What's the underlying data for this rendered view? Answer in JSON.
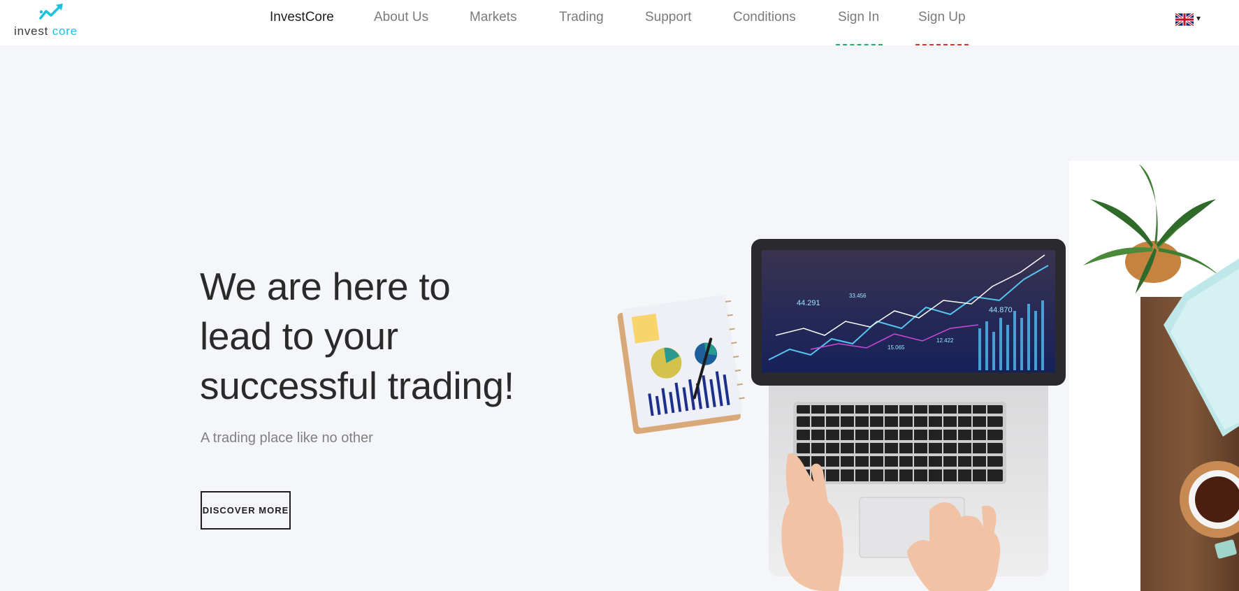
{
  "header": {
    "logo": {
      "part1": "invest",
      "part2": "core"
    },
    "nav": [
      {
        "label": "InvestCore",
        "active": true
      },
      {
        "label": "About Us"
      },
      {
        "label": "Markets"
      },
      {
        "label": "Trading"
      },
      {
        "label": "Support"
      },
      {
        "label": "Conditions"
      },
      {
        "label": "Sign In",
        "underline_color": "#1db36a"
      },
      {
        "label": "Sign Up",
        "underline_color": "#e0332c"
      }
    ],
    "language": {
      "flag": "uk-flag-icon",
      "chevron": "▾"
    }
  },
  "hero": {
    "title_lines": [
      "We are here to",
      "lead to your",
      "successful trading!"
    ],
    "subtitle": "A trading place like no other",
    "cta": "DISCOVER MORE"
  },
  "illustration": {
    "screen_labels": [
      "44.291",
      "44.870",
      "12.422",
      "15.065",
      "33.456"
    ]
  },
  "colors": {
    "brand": "#18c3dd",
    "background": "#f5f6f9"
  }
}
